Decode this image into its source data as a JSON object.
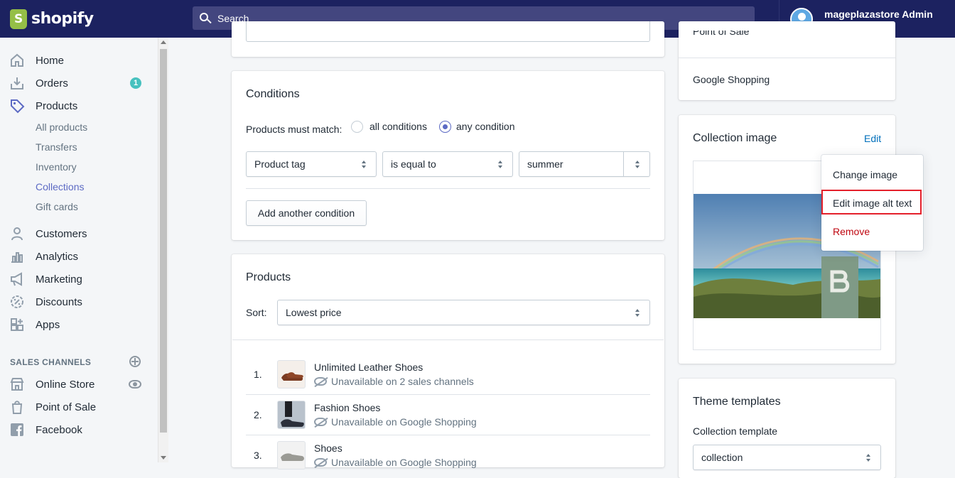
{
  "app": {
    "brand": "shopify"
  },
  "search": {
    "placeholder": "Search"
  },
  "account": {
    "name": "mageplazastore Admin",
    "store": "mageplazastore"
  },
  "sidebar": {
    "items": [
      {
        "label": "Home",
        "icon": "home-icon"
      },
      {
        "label": "Orders",
        "icon": "orders-icon",
        "badge": "1"
      },
      {
        "label": "Products",
        "icon": "tag-icon"
      },
      {
        "label": "Customers",
        "icon": "person-icon"
      },
      {
        "label": "Analytics",
        "icon": "bar-chart-icon"
      },
      {
        "label": "Marketing",
        "icon": "megaphone-icon"
      },
      {
        "label": "Discounts",
        "icon": "discount-icon"
      },
      {
        "label": "Apps",
        "icon": "apps-icon"
      }
    ],
    "product_sub": [
      "All products",
      "Transfers",
      "Inventory",
      "Collections",
      "Gift cards"
    ],
    "active_sub": "Collections",
    "channels_heading": "SALES CHANNELS",
    "channels": [
      {
        "label": "Online Store",
        "icon": "store-icon"
      },
      {
        "label": "Point of Sale",
        "icon": "pos-bag-icon"
      },
      {
        "label": "Facebook",
        "icon": "facebook-icon"
      }
    ]
  },
  "conditions": {
    "title": "Conditions",
    "match_label": "Products must match:",
    "options": [
      "all conditions",
      "any condition"
    ],
    "selected": "any condition",
    "rule": {
      "field": "Product tag",
      "operator": "is equal to",
      "value": "summer"
    },
    "add_button": "Add another condition"
  },
  "products": {
    "title": "Products",
    "sort_label": "Sort:",
    "sort_value": "Lowest price",
    "items": [
      {
        "num": "1.",
        "name": "Unlimited Leather Shoes",
        "status": "Unavailable on 2 sales channels"
      },
      {
        "num": "2.",
        "name": "Fashion Shoes",
        "status": "Unavailable on Google Shopping"
      },
      {
        "num": "3.",
        "name": "Shoes",
        "status": "Unavailable on Google Shopping"
      }
    ]
  },
  "right": {
    "channel_partial": "Point of Sale",
    "channel_google": "Google Shopping",
    "image_card_title": "Collection image",
    "edit_link": "Edit",
    "menu": {
      "change": "Change image",
      "alt": "Edit image alt text",
      "remove": "Remove"
    },
    "theme_title": "Theme templates",
    "template_label": "Collection template",
    "template_value": "collection"
  },
  "colors": {
    "topbar": "#1c2260",
    "accent": "#5c6ac4",
    "danger": "#bf0711",
    "highlight": "#e4202b"
  }
}
